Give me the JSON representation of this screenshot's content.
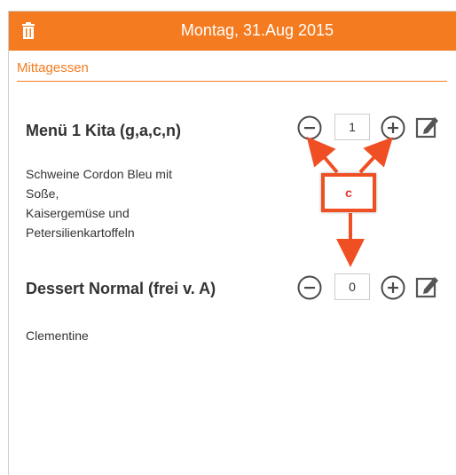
{
  "header": {
    "title": "Montag, 31.Aug 2015",
    "icon": "trash-icon",
    "background_color": "#f47b20"
  },
  "section": {
    "label": "Mittagessen"
  },
  "items": [
    {
      "name": "Menü 1 Kita (g,a,c,n)",
      "description": "Schweine Cordon Bleu mit\nSoße,\nKaisergemüse und\nPetersilienkartoffeln",
      "quantity": "1"
    },
    {
      "name": "Dessert Normal (frei v. A)",
      "description": "Clementine",
      "quantity": "0"
    }
  ],
  "annotation": {
    "label": "c",
    "color": "#f04f23"
  }
}
